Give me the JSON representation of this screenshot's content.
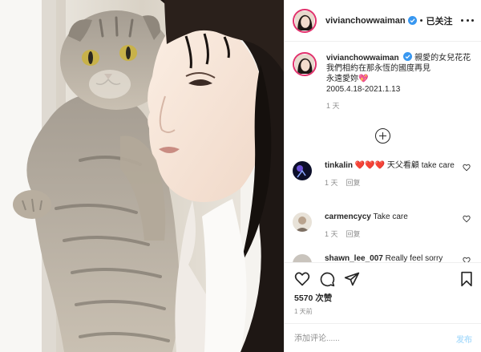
{
  "header": {
    "username": "vivianchowwaiman",
    "separator": "•",
    "follow_label": "已关注"
  },
  "caption": {
    "username": "vivianchowwaiman",
    "text_line1": "親愛的女兒花花",
    "text_line2": "我們相約在那永恆的國度再見",
    "text_line3": "永遠愛妳",
    "emoji": "💖",
    "dates": "2005.4.18-2021.1.13",
    "time": "1 天"
  },
  "comments": [
    {
      "username": "tinkalin",
      "text": "❤️❤️❤️ 天父看顧 take care",
      "time": "1 天",
      "reply": "回复"
    },
    {
      "username": "carmencycy",
      "text": "Take care",
      "time": "1 天",
      "reply": "回复"
    },
    {
      "username": "shawn_lee_007",
      "text": "Really feel sorry"
    }
  ],
  "actions": {
    "icons": [
      "heart-icon",
      "comment-icon",
      "share-icon",
      "bookmark-icon"
    ],
    "likes": "5570 次赞",
    "posted": "1 天前"
  },
  "add_comment": {
    "placeholder": "添加评论......",
    "post_label": "发布"
  },
  "colors": {
    "verified_blue": "#3897f0",
    "heart_red": "#ed4956",
    "post_button": "#b2dffc",
    "story_ring": "#e1306c"
  }
}
